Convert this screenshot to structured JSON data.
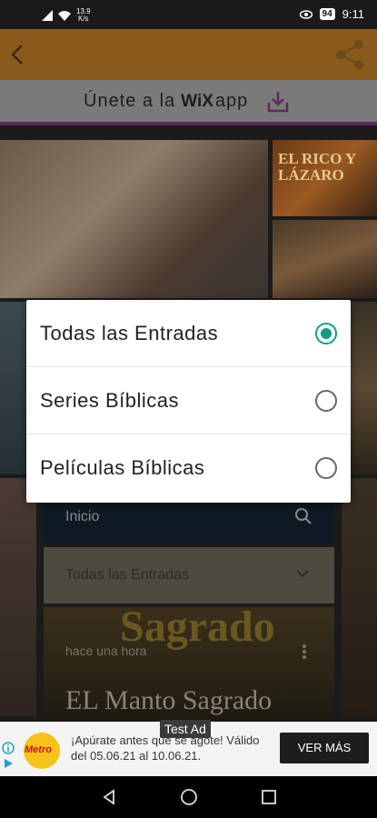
{
  "status_bar": {
    "net_speed": "13.9",
    "net_unit": "K/s",
    "battery": "94",
    "time": "9:11"
  },
  "join_banner": {
    "text": "Únete a la",
    "wix": "WiX",
    "app": "app"
  },
  "background_card": {
    "tile_title": "EL RICO Y LÁZARO",
    "search_label": "Inicio",
    "filter_label": "Todas las Entradas",
    "post_bg_word": "Sagrado",
    "post_time": "hace una hora",
    "post_title": "EL Manto Sagrado"
  },
  "dialog": {
    "options": [
      {
        "label": "Todas las Entradas",
        "selected": true
      },
      {
        "label": "Series Bíblicas",
        "selected": false
      },
      {
        "label": "Películas Bíblicas",
        "selected": false
      }
    ]
  },
  "ad": {
    "label": "Test Ad",
    "logo": "Metro",
    "text": "¡Apúrate antes que se agote! Válido del 05.06.21 al 10.06.21.",
    "cta": "VER MÁS"
  },
  "colors": {
    "accent": "#149e80",
    "appbar": "#8a5a1c",
    "joinbar_line": "#5b2a5a"
  },
  "icons": [
    "back-icon",
    "share-icon",
    "download-icon",
    "search-icon",
    "chevron-down-icon",
    "more-vert-icon",
    "nav-back-icon",
    "nav-home-icon",
    "nav-recents-icon"
  ]
}
